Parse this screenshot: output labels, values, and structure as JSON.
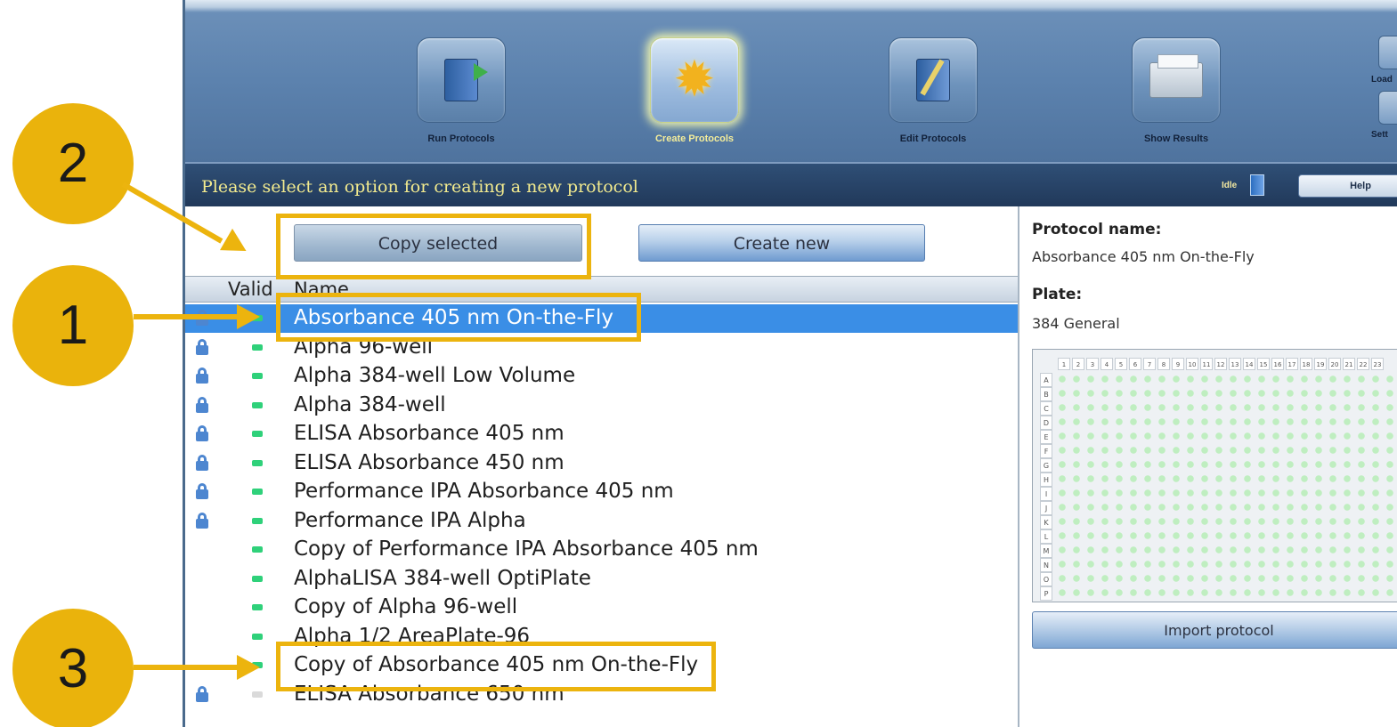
{
  "toolbar": {
    "items": [
      {
        "label": "Run Protocols",
        "icon": "run-protocols-icon",
        "active": false
      },
      {
        "label": "Create Protocols",
        "icon": "create-protocols-icon",
        "active": true
      },
      {
        "label": "Edit Protocols",
        "icon": "edit-protocols-icon",
        "active": false
      },
      {
        "label": "Show Results",
        "icon": "show-results-icon",
        "active": false
      }
    ],
    "side": {
      "load_label": "Load",
      "settings_label": "Sett"
    }
  },
  "status": {
    "message": "Please select an option for creating a new protocol",
    "idle_label": "Idle",
    "help_label": "Help"
  },
  "actions": {
    "copy_label": "Copy selected",
    "create_label": "Create new"
  },
  "list": {
    "columns": {
      "valid": "Valid",
      "name": "Name"
    },
    "rows": [
      {
        "name": "Absorbance 405 nm On-the-Fly",
        "locked": true,
        "valid": true,
        "selected": true
      },
      {
        "name": "Alpha 96-well",
        "locked": true,
        "valid": true,
        "selected": false
      },
      {
        "name": "Alpha 384-well Low Volume",
        "locked": true,
        "valid": true,
        "selected": false
      },
      {
        "name": "Alpha 384-well",
        "locked": true,
        "valid": true,
        "selected": false
      },
      {
        "name": "ELISA Absorbance 405 nm",
        "locked": true,
        "valid": true,
        "selected": false
      },
      {
        "name": "ELISA Absorbance 450 nm",
        "locked": true,
        "valid": true,
        "selected": false
      },
      {
        "name": "Performance IPA Absorbance 405 nm",
        "locked": true,
        "valid": true,
        "selected": false
      },
      {
        "name": "Performance IPA Alpha",
        "locked": true,
        "valid": true,
        "selected": false
      },
      {
        "name": "Copy of Performance IPA Absorbance 405 nm",
        "locked": false,
        "valid": true,
        "selected": false
      },
      {
        "name": "AlphaLISA 384-well OptiPlate",
        "locked": false,
        "valid": true,
        "selected": false
      },
      {
        "name": "Copy of Alpha 96-well",
        "locked": false,
        "valid": true,
        "selected": false
      },
      {
        "name": "Alpha 1/2 AreaPlate-96",
        "locked": false,
        "valid": true,
        "selected": false
      },
      {
        "name": "Copy of Absorbance 405 nm On-the-Fly",
        "locked": false,
        "valid": true,
        "selected": false
      },
      {
        "name": "ELISA Absorbance 650 nm",
        "locked": true,
        "valid": false,
        "selected": false
      }
    ]
  },
  "details": {
    "protocol_name_label": "Protocol name:",
    "protocol_name_value": "Absorbance 405 nm On-the-Fly",
    "plate_label": "Plate:",
    "plate_value": "384 General",
    "plate_columns": [
      "1",
      "2",
      "3",
      "4",
      "5",
      "6",
      "7",
      "8",
      "9",
      "10",
      "11",
      "12",
      "13",
      "14",
      "15",
      "16",
      "17",
      "18",
      "19",
      "20",
      "21",
      "22",
      "23"
    ],
    "plate_rows": [
      "A",
      "B",
      "C",
      "D",
      "E",
      "F",
      "G",
      "H",
      "I",
      "J",
      "K",
      "L",
      "M",
      "N",
      "O",
      "P"
    ],
    "import_label": "Import protocol"
  },
  "annotations": {
    "step_1": "1",
    "step_2": "2",
    "step_3": "3",
    "color": "#eab30c"
  }
}
